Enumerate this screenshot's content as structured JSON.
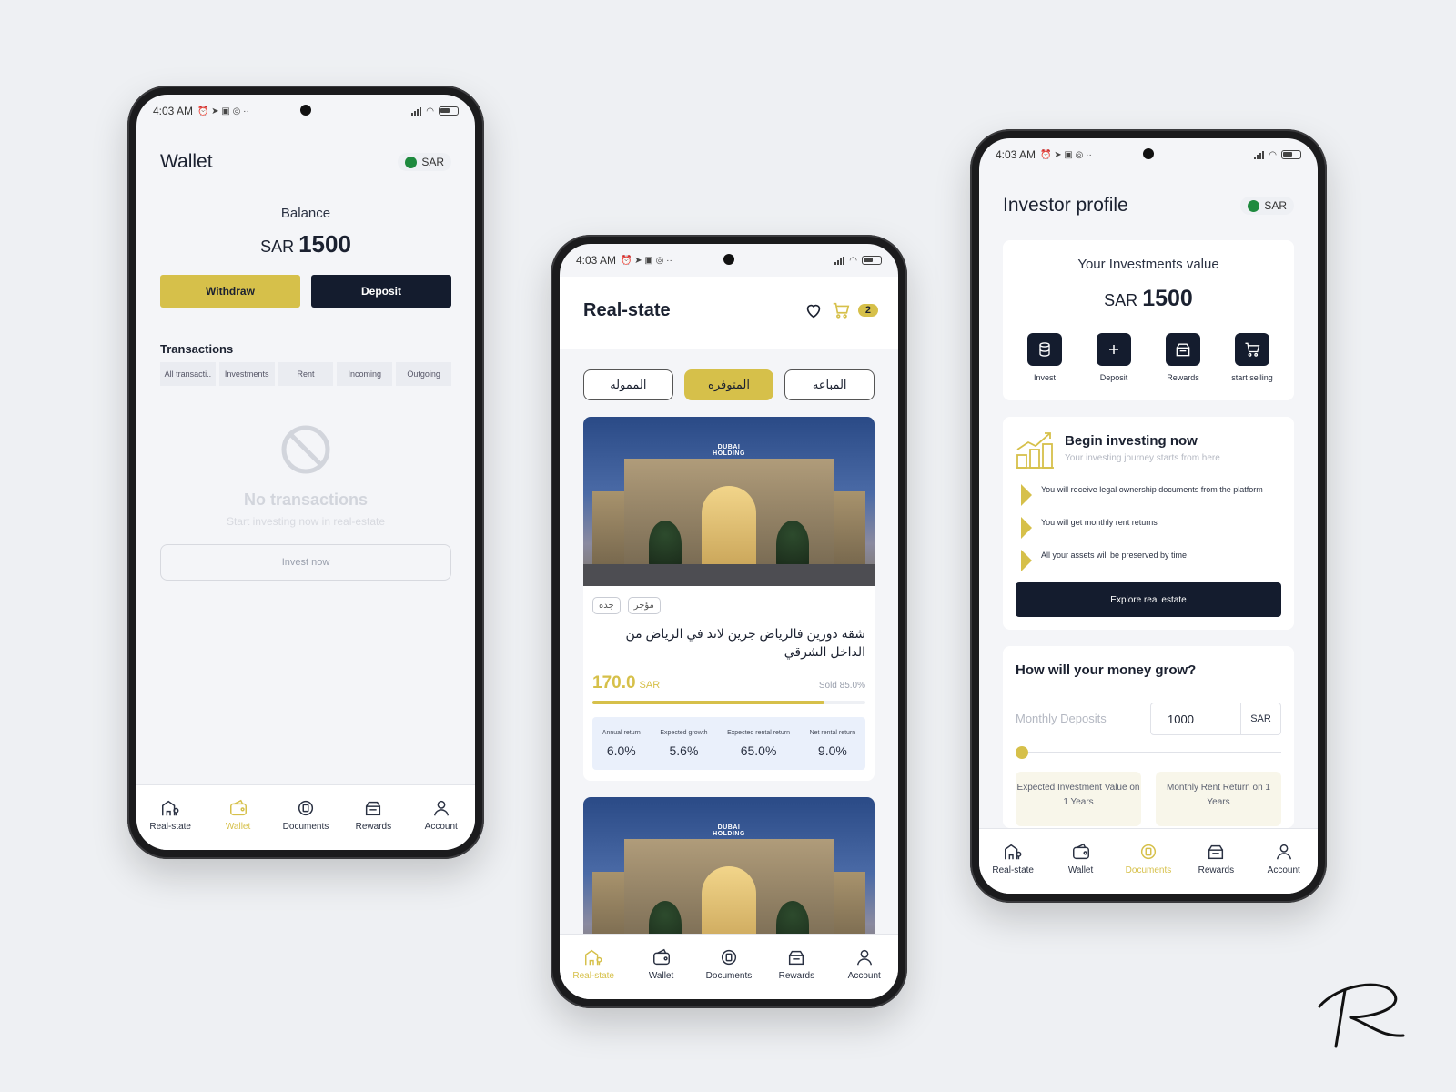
{
  "status": {
    "time": "4:03 AM"
  },
  "nav": {
    "realstate": "Real-state",
    "wallet": "Wallet",
    "documents": "Documents",
    "rewards": "Rewards",
    "account": "Account"
  },
  "wallet": {
    "title": "Wallet",
    "currency_chip": "SAR",
    "balance_label": "Balance",
    "balance_currency": "SAR",
    "balance_value": "1500",
    "withdraw_label": "Withdraw",
    "deposit_label": "Deposit",
    "transactions_title": "Transactions",
    "tabs": [
      "All transacti..",
      "Investments",
      "Rent",
      "Incoming",
      "Outgoing"
    ],
    "empty_title": "No transactions",
    "empty_subtitle": "Start investing now in real-estate",
    "invest_now_label": "Invest now"
  },
  "realstate": {
    "title": "Real-state",
    "cart_count": "2",
    "segments": [
      "المموله",
      "المتوفره",
      "المباعه"
    ],
    "card": {
      "photo_logo": "DUBAI HOLDING",
      "tags": [
        "جده",
        "مؤجر"
      ],
      "title": "شقه دورين فالرياض جرين لاند في الرياض من الداخل الشرقي",
      "price": "170.0",
      "price_currency": "SAR",
      "sold_label": "Sold 85.0%",
      "sold_fraction": 0.85,
      "stats": [
        {
          "label": "Annual return",
          "value": "6.0%"
        },
        {
          "label": "Expected growth",
          "value": "5.6%"
        },
        {
          "label": "Expected rental return",
          "value": "65.0%"
        },
        {
          "label": "Net rental return",
          "value": "9.0%"
        }
      ]
    }
  },
  "investor": {
    "title": "Investor profile",
    "currency_chip": "SAR",
    "investments_label": "Your Investments value",
    "investments_currency": "SAR",
    "investments_value": "1500",
    "quick_actions": [
      "Invest",
      "Deposit",
      "Rewards",
      "start selling"
    ],
    "begin_title": "Begin investing now",
    "begin_subtitle": "Your investing journey starts from here",
    "bullets": [
      "You will receive legal ownership documents from the platform",
      "You will get monthly rent returns",
      "All your assets will be preserved by time"
    ],
    "explore_label": "Explore real estate",
    "grow_title": "How will your money grow?",
    "monthly_deposits_label": "Monthly Deposits",
    "deposit_value": "1000",
    "deposit_unit": "SAR",
    "result_1": "Expected Investment Value on 1 Years",
    "result_2": "Monthly Rent Return on 1 Years"
  },
  "colors": {
    "gold": "#d6c04a",
    "navy": "#141c2e"
  }
}
